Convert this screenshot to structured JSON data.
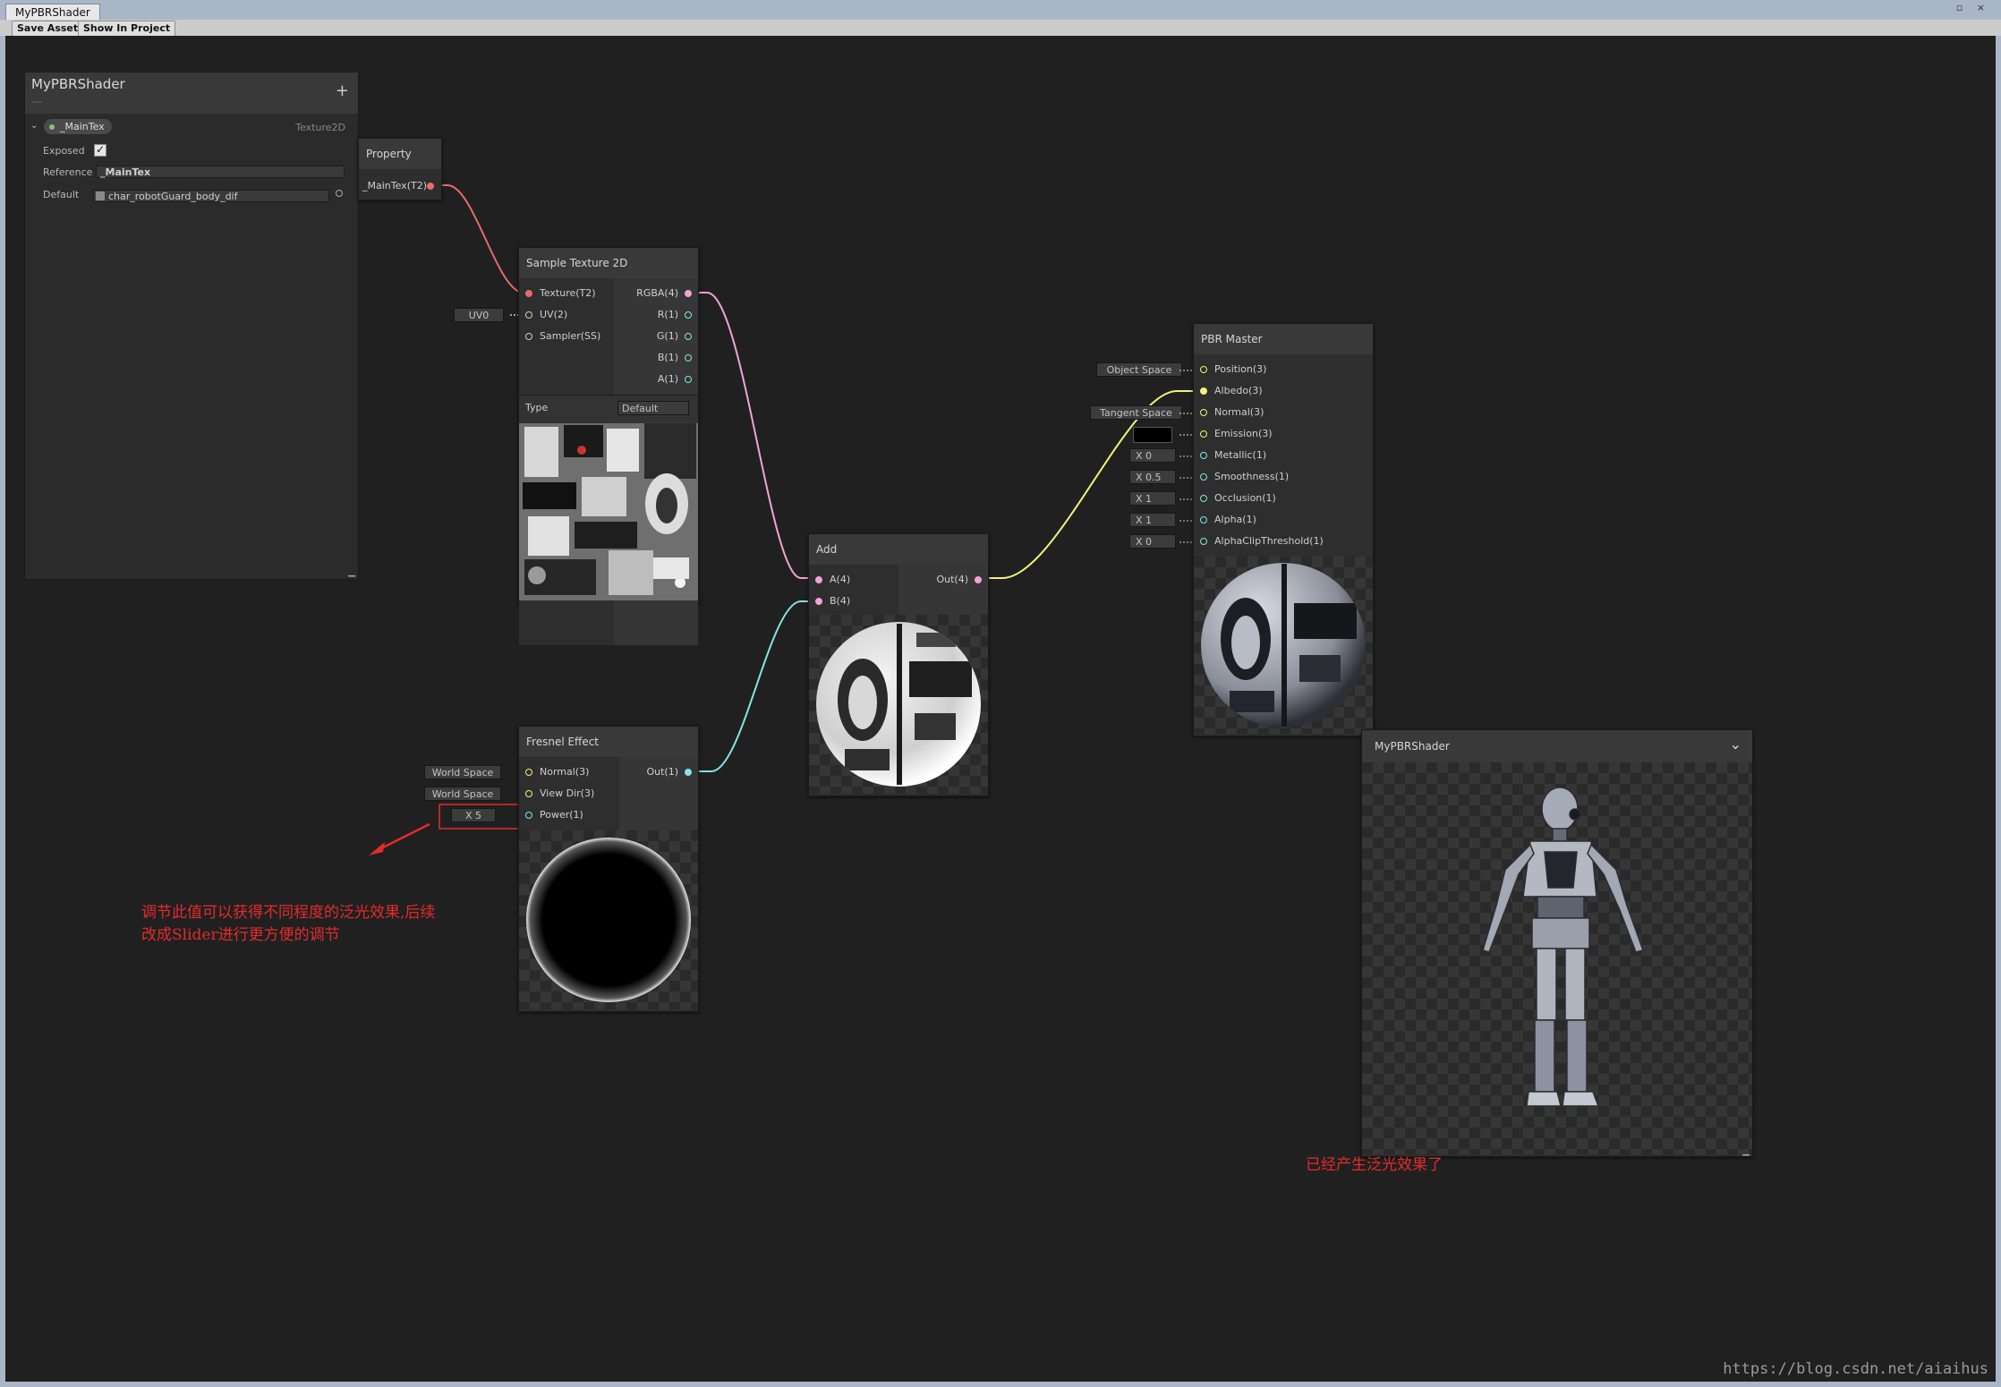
{
  "window": {
    "tab_title": "MyPBRShader",
    "save_asset": "Save Asset",
    "show_in_project": "Show In Project"
  },
  "blackboard": {
    "title": "MyPBRShader",
    "subtitle": "---",
    "add": "+",
    "property_name": "_MainTex",
    "property_type": "Texture2D",
    "exposed_label": "Exposed",
    "reference_label": "Reference",
    "reference_value": "_MainTex",
    "default_label": "Default",
    "default_value": "char_robotGuard_body_dif"
  },
  "property_node": {
    "title": "Property",
    "output": "_MainTex(T2)"
  },
  "sample_texture": {
    "title": "Sample Texture 2D",
    "inputs": [
      "Texture(T2)",
      "UV(2)",
      "Sampler(SS)"
    ],
    "outputs": [
      "RGBA(4)",
      "R(1)",
      "G(1)",
      "B(1)",
      "A(1)"
    ],
    "uv_chip": "UV0",
    "type_label": "Type",
    "type_value": "Default"
  },
  "fresnel": {
    "title": "Fresnel Effect",
    "inputs": [
      "Normal(3)",
      "View Dir(3)",
      "Power(1)"
    ],
    "output": "Out(1)",
    "chips": [
      "World Space",
      "World Space",
      "X  5"
    ]
  },
  "add_node": {
    "title": "Add",
    "inputs": [
      "A(4)",
      "B(4)"
    ],
    "output": "Out(4)"
  },
  "pbr_master": {
    "title": "PBR Master",
    "inputs": [
      "Position(3)",
      "Albedo(3)",
      "Normal(3)",
      "Emission(3)",
      "Metallic(1)",
      "Smoothness(1)",
      "Occlusion(1)",
      "Alpha(1)",
      "AlphaClipThreshold(1)"
    ],
    "chips": [
      "Object Space",
      "Tangent Space",
      "X  0",
      "X  0.5",
      "X  1",
      "X  1",
      "X  0"
    ]
  },
  "preview": {
    "title": "MyPBRShader",
    "dropdown": "⌄"
  },
  "annotations": {
    "left_line1": "调节此值可以获得不同程度的泛光效果,后续",
    "left_line2": "改成Slider进行更方便的调节",
    "right": "已经产生泛光效果了"
  },
  "watermark": "https://blog.csdn.net/aiaihus",
  "colors": {
    "texture_port": "#e86b6b",
    "vector4_port": "#f2a3d8",
    "vector3_port": "#f2f27a",
    "vector2_port": "#b5e4a3",
    "vector1_port": "#84e4e7",
    "annotation": "#e62a2a"
  }
}
